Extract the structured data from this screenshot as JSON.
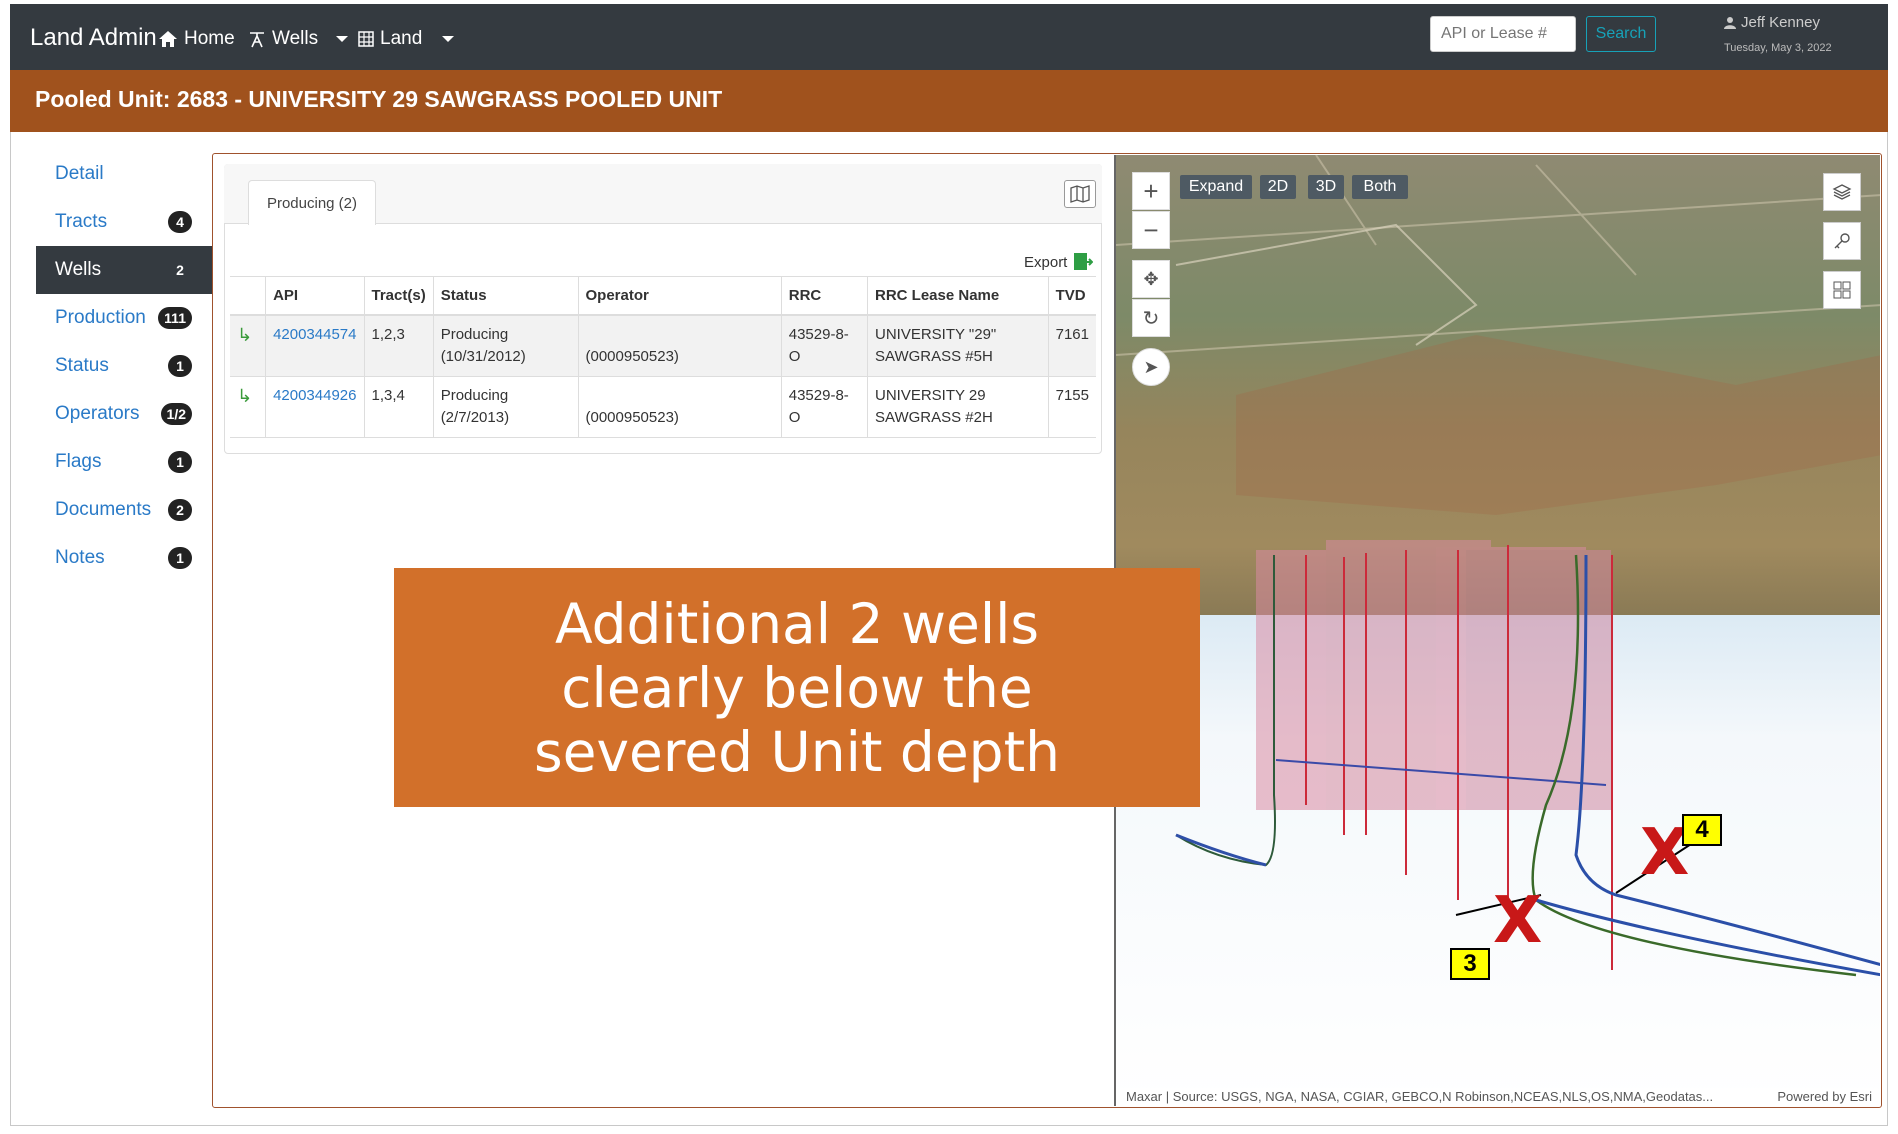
{
  "navbar": {
    "brand": "Land Admin",
    "home": "Home",
    "wells": "Wells",
    "land": "Land",
    "search_placeholder": "API or Lease #",
    "search_button": "Search",
    "user": "Jeff Kenney",
    "date": "Tuesday, May 3, 2022"
  },
  "title": "Pooled Unit: 2683 - UNIVERSITY 29 SAWGRASS POOLED UNIT",
  "sidebar": {
    "items": [
      {
        "label": "Detail",
        "badge": ""
      },
      {
        "label": "Tracts",
        "badge": "4"
      },
      {
        "label": "Wells",
        "badge": "2"
      },
      {
        "label": "Production",
        "badge": "111"
      },
      {
        "label": "Status",
        "badge": "1"
      },
      {
        "label": "Operators",
        "badge": "1/2"
      },
      {
        "label": "Flags",
        "badge": "1"
      },
      {
        "label": "Documents",
        "badge": "2"
      },
      {
        "label": "Notes",
        "badge": "1"
      }
    ]
  },
  "wells_card": {
    "tab": "Producing (2)",
    "export": "Export",
    "columns": [
      "API",
      "Tract(s)",
      "Status",
      "Operator",
      "RRC",
      "RRC Lease Name",
      "TVD"
    ],
    "rows": [
      {
        "api": "4200344574",
        "tracts": "1,2,3",
        "status_1": "Producing",
        "status_2": "(10/31/2012)",
        "operator": "(0000950523)",
        "rrc": "43529-8-O",
        "lease_1": "UNIVERSITY \"29\"",
        "lease_2": "SAWGRASS #5H",
        "tvd": "7161"
      },
      {
        "api": "4200344926",
        "tracts": "1,3,4",
        "status_1": "Producing",
        "status_2": "(2/7/2013)",
        "operator": "(0000950523)",
        "rrc": "43529-8-O",
        "lease_1": "UNIVERSITY 29",
        "lease_2": "SAWGRASS #2H",
        "tvd": "7155"
      }
    ]
  },
  "map": {
    "buttons": {
      "expand": "Expand",
      "two_d": "2D",
      "three_d": "3D",
      "both": "Both"
    },
    "attribution": "Maxar | Source: USGS, NGA, NASA, CGIAR, GEBCO,N Robinson,NCEAS,NLS,OS,NMA,Geodatas...",
    "powered_by": "Powered by Esri",
    "label_3": "3",
    "label_4": "4",
    "x_mark": "X"
  },
  "callout": {
    "line1": "Additional 2 wells",
    "line2": "clearly below the",
    "line3": "severed Unit depth"
  },
  "colors": {
    "navbar": "#343a40",
    "titlebar": "#a0521d",
    "callout": "#d2702a",
    "link": "#2a7ac7"
  }
}
